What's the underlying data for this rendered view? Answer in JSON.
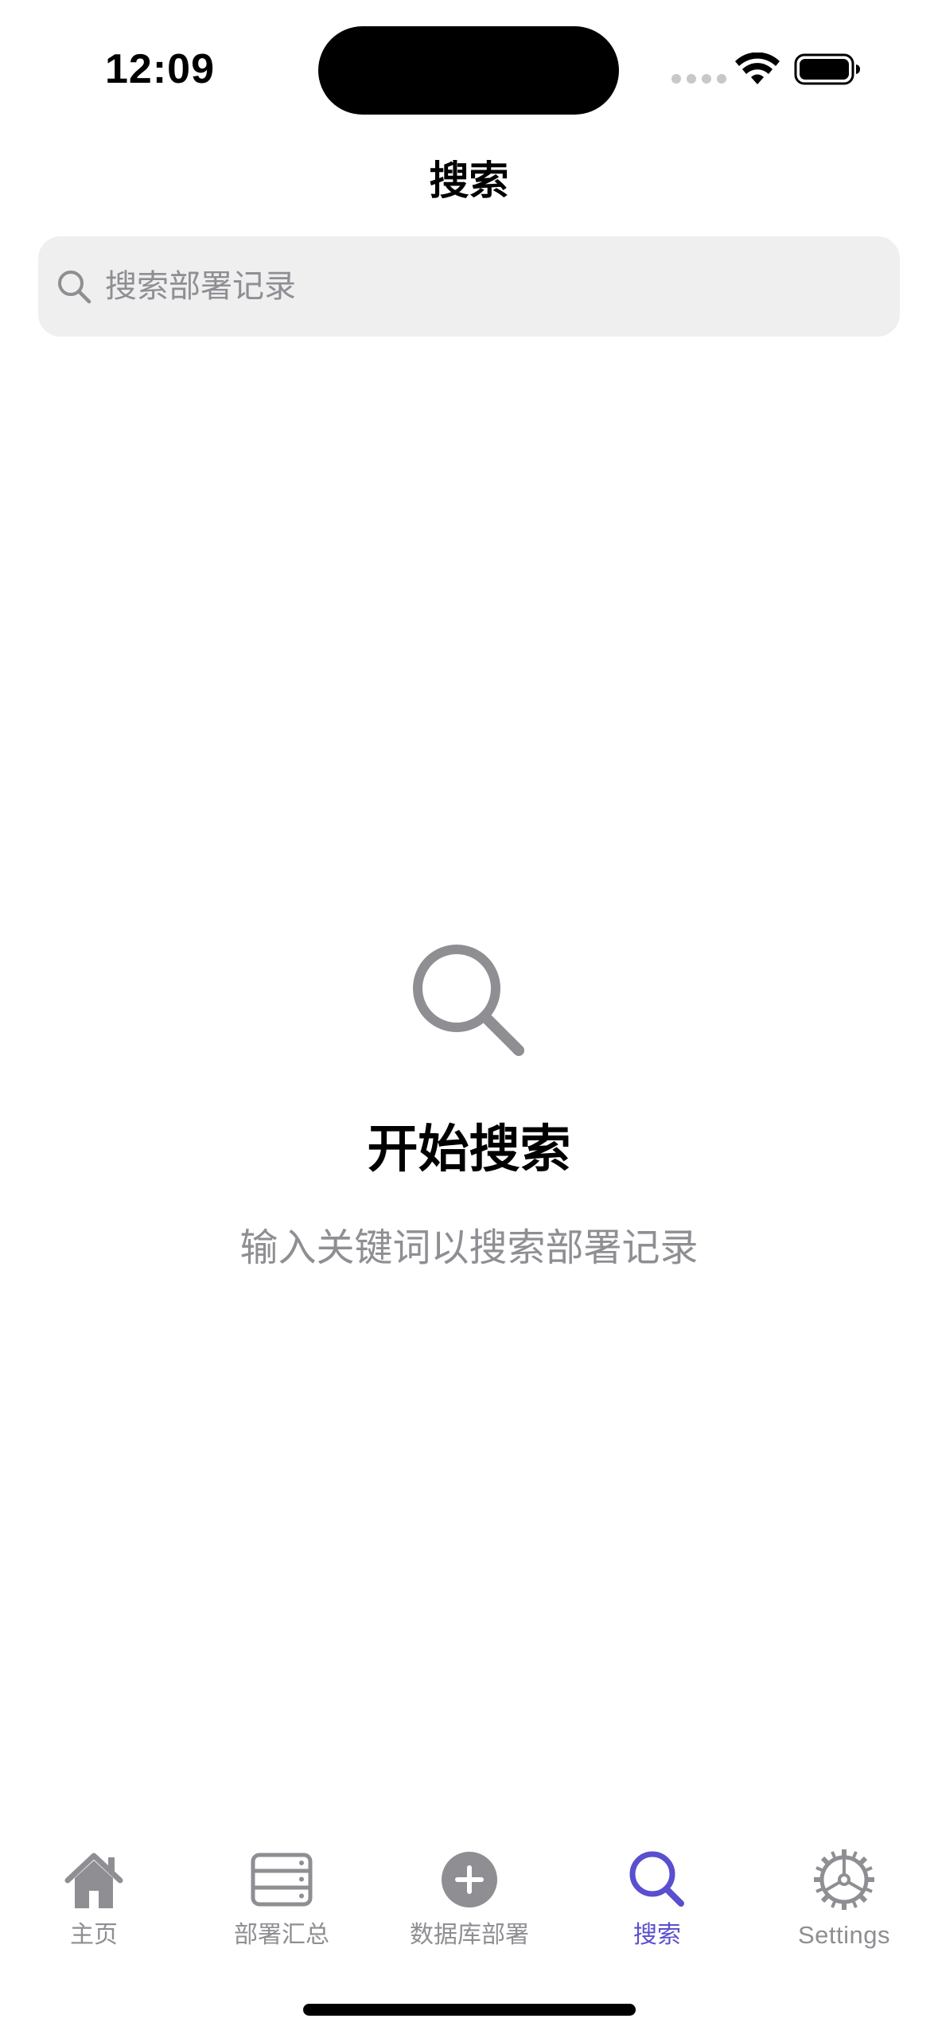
{
  "status_bar": {
    "time": "12:09",
    "icons": [
      "signal-dots-icon",
      "wifi-icon",
      "battery-icon"
    ]
  },
  "nav": {
    "title": "搜索"
  },
  "search": {
    "placeholder": "搜索部署记录",
    "value": "",
    "icon": "search-icon"
  },
  "empty_state": {
    "icon": "search-icon",
    "title": "开始搜索",
    "subtitle": "输入关键词以搜索部署记录"
  },
  "tab_bar": {
    "items": [
      {
        "label": "主页",
        "icon": "house-icon",
        "active": false
      },
      {
        "label": "部署汇总",
        "icon": "server-rack-icon",
        "active": false
      },
      {
        "label": "数据库部署",
        "icon": "plus-circle-icon",
        "active": false
      },
      {
        "label": "搜索",
        "icon": "search-icon",
        "active": true
      },
      {
        "label": "Settings",
        "icon": "gear-icon",
        "active": false
      }
    ]
  },
  "colors": {
    "accent": "#5a4fcf",
    "inactive": "#8e8e93",
    "search_field_bg": "#efeff0",
    "text_primary": "#000000"
  }
}
